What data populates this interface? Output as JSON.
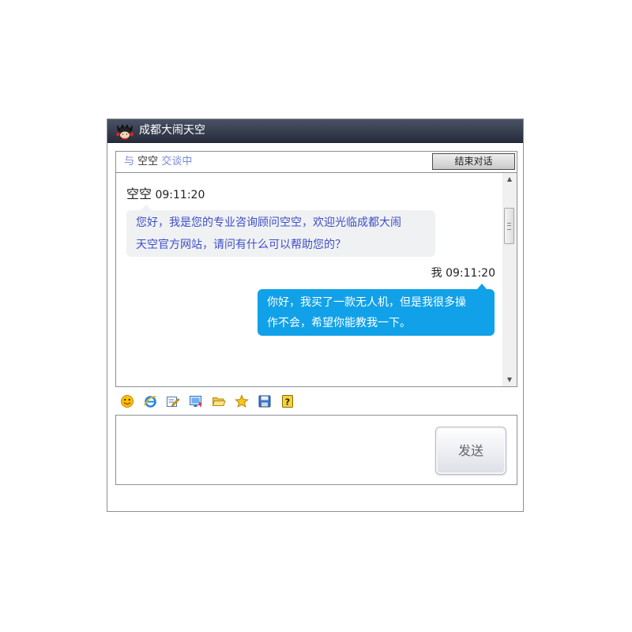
{
  "window": {
    "title": "成都大闹天空"
  },
  "chat_header": {
    "prefix": "与",
    "name": "空空",
    "suffix": "交谈中",
    "end_button": "结束对话"
  },
  "messages": [
    {
      "side": "left",
      "sender": "空空",
      "time": "09:11:20",
      "lines": [
        "您好，我是您的专业咨询顾问空空，欢迎光临成都大闹",
        "天空官方网站，请问有什么可以帮助您的？"
      ]
    },
    {
      "side": "right",
      "sender": "我",
      "time": "09:11:20",
      "lines": [
        "你好，我买了一款无人机，但是我很多操",
        "作不会，希望你能教我一下。"
      ]
    }
  ],
  "toolbar": {
    "icons": [
      "emoticon-icon",
      "browser-icon",
      "edit-icon",
      "screenshot-icon",
      "open-folder-icon",
      "favorite-star-icon",
      "save-icon",
      "help-icon"
    ]
  },
  "input": {
    "value": "",
    "send_button": "发送"
  },
  "colors": {
    "titlebar": "#2f3647",
    "my_bubble": "#11a1e8",
    "agent_text": "#3d4fc9",
    "agent_bubble": "#f0f1f3"
  }
}
